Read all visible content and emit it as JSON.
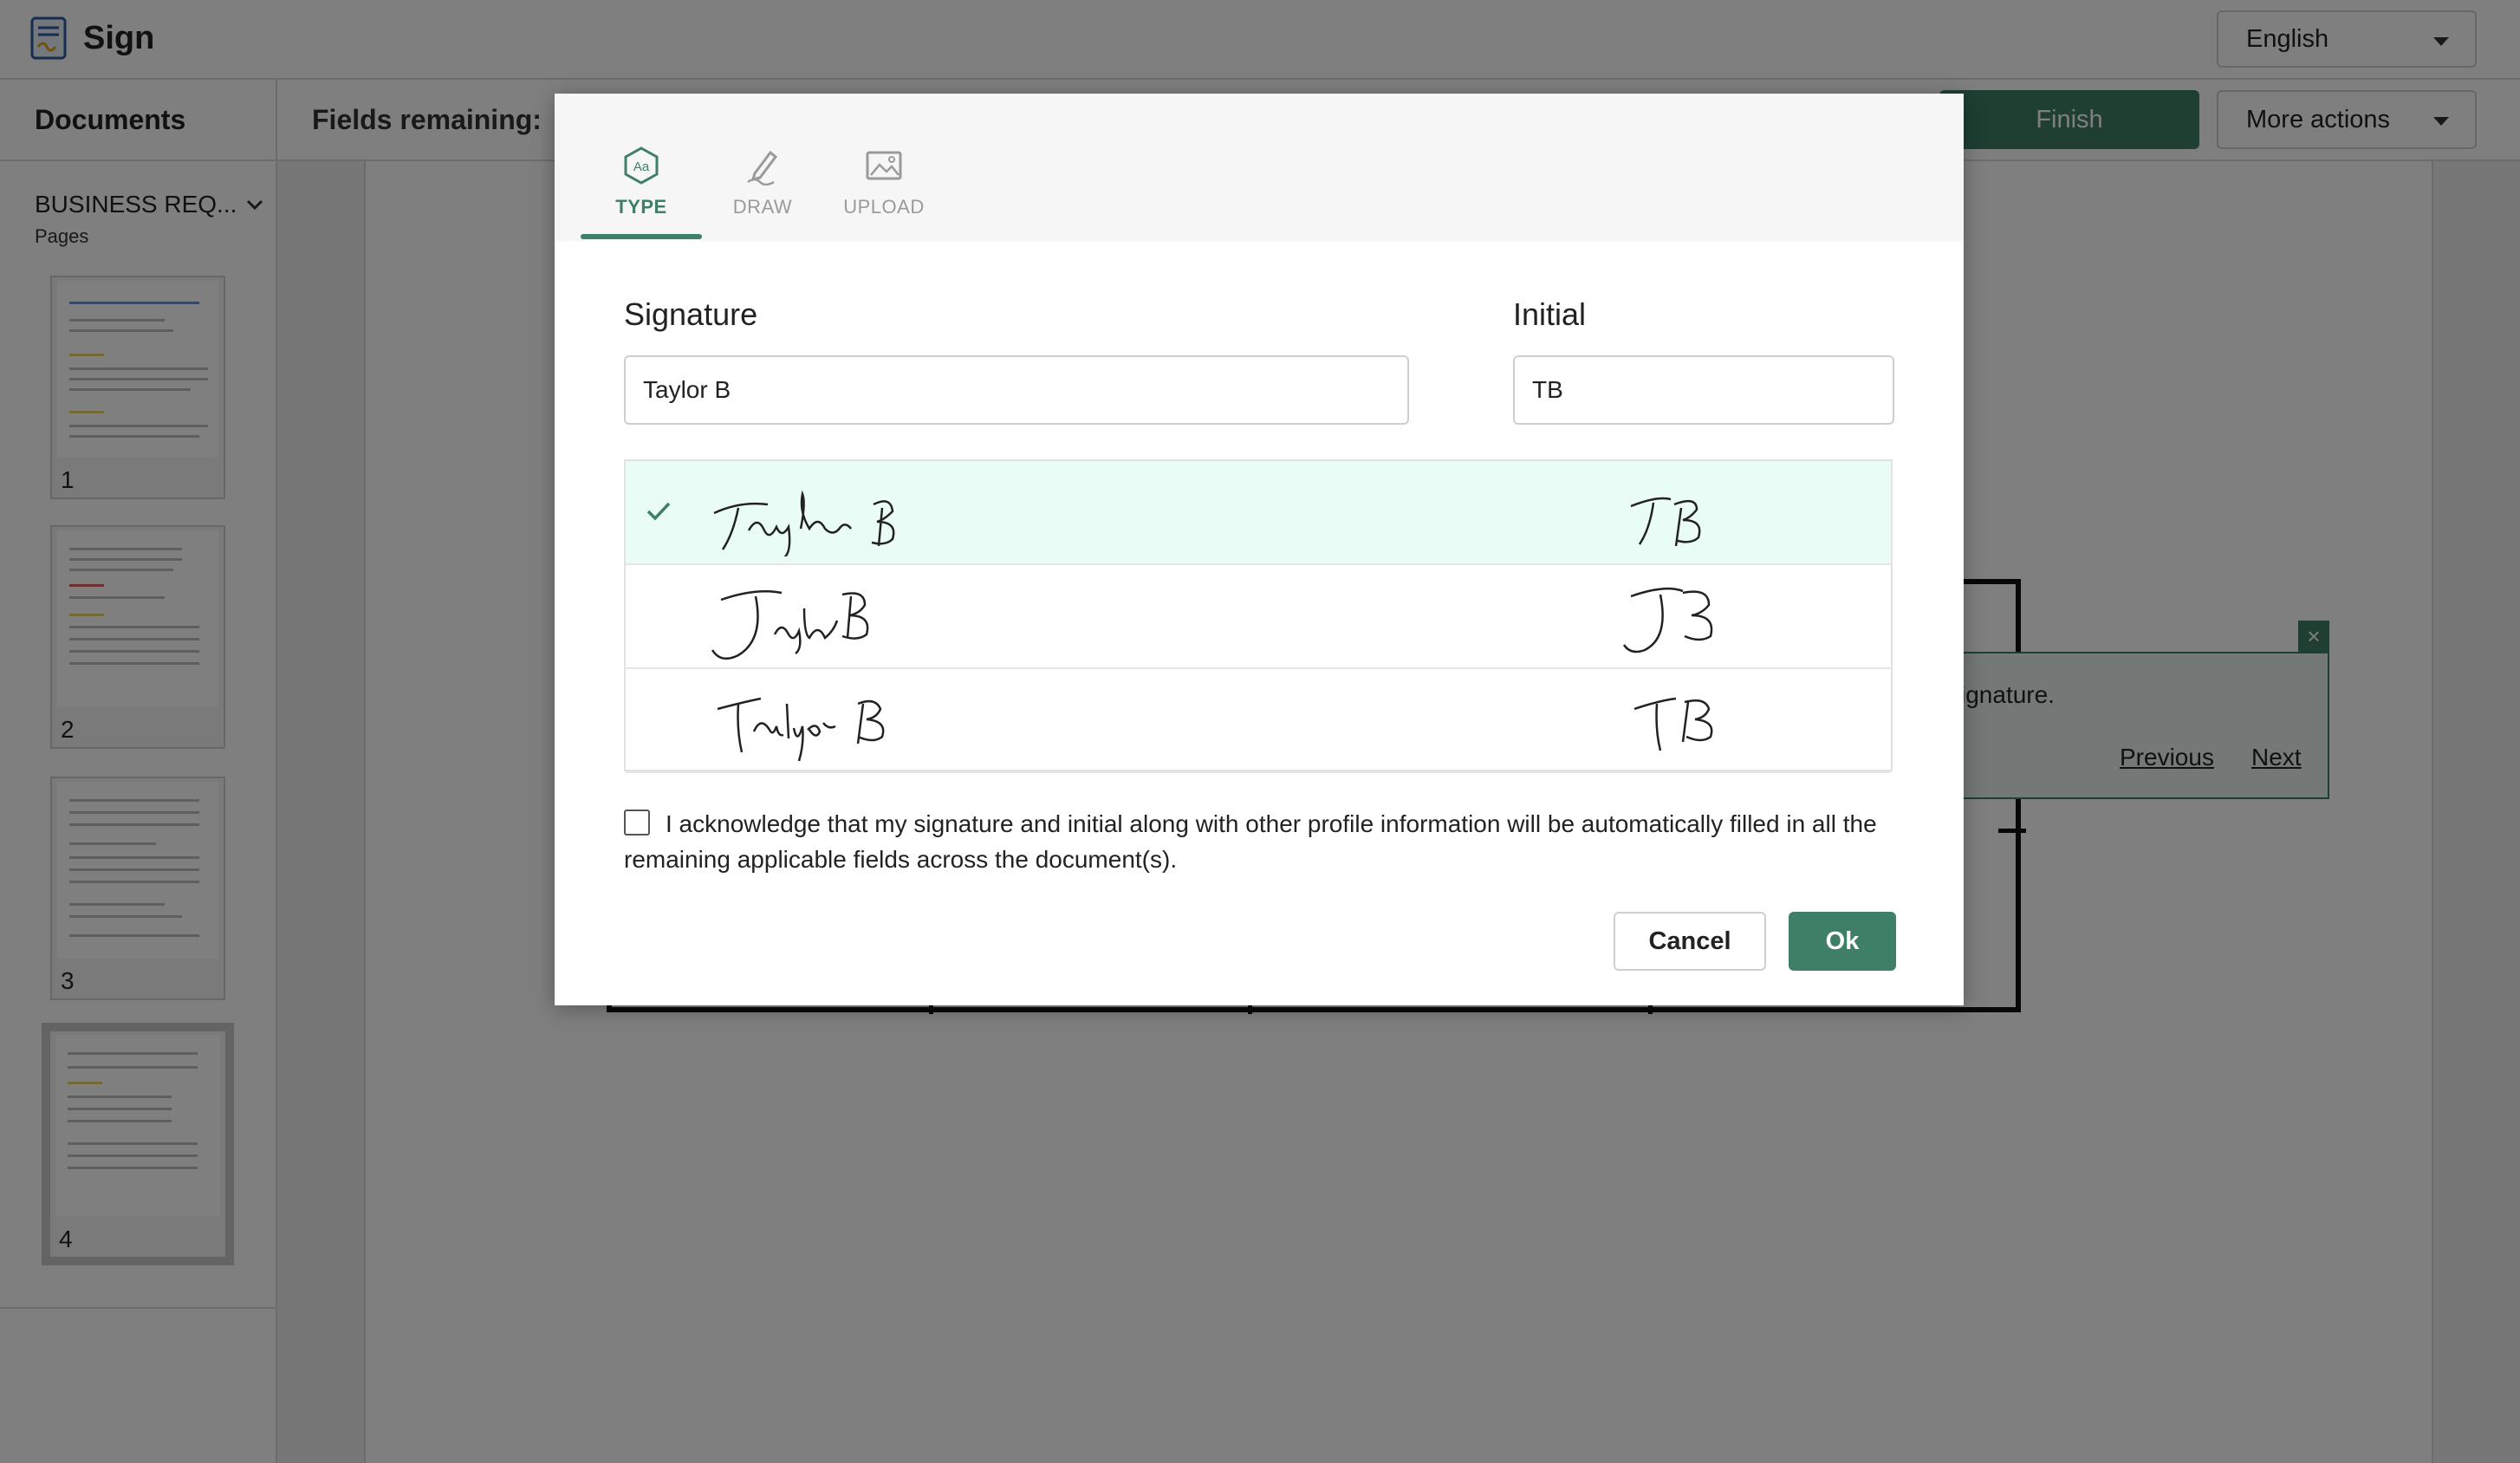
{
  "app": {
    "title": "Sign",
    "language": "English",
    "documents_label": "Documents",
    "fields_remaining_label": "Fields remaining:",
    "finish_label": "Finish",
    "more_actions_label": "More actions"
  },
  "sidebar": {
    "document_name": "BUSINESS REQ...",
    "pages_label": "Pages",
    "pages": [
      "1",
      "2",
      "3",
      "4"
    ],
    "active_page": "4"
  },
  "tip": {
    "text": "ignature.",
    "previous_label": "Previous",
    "next_label": "Next",
    "close_icon": "close-icon"
  },
  "modal": {
    "tabs": [
      {
        "label": "TYPE",
        "icon": "type-text-icon",
        "active": true
      },
      {
        "label": "DRAW",
        "icon": "pen-draw-icon",
        "active": false
      },
      {
        "label": "UPLOAD",
        "icon": "image-upload-icon",
        "active": false
      }
    ],
    "signature_label": "Signature",
    "signature_value": "Taylor B",
    "initial_label": "Initial",
    "initial_value": "TB",
    "style_options": [
      {
        "signature": "Taylor B",
        "initial": "TB",
        "selected": true
      },
      {
        "signature": "Taylor B",
        "initial": "TB",
        "selected": false
      },
      {
        "signature": "Taylor B",
        "initial": "TB",
        "selected": false
      }
    ],
    "acknowledge_text": "I acknowledge that my signature and initial along with other profile information will be automatically filled in all the remaining applicable fields across the document(s).",
    "acknowledge_checked": false,
    "cancel_label": "Cancel",
    "ok_label": "Ok"
  },
  "colors": {
    "accent": "#3f7f67",
    "selected_row": "#eafcf6",
    "overlay": "#000000"
  }
}
